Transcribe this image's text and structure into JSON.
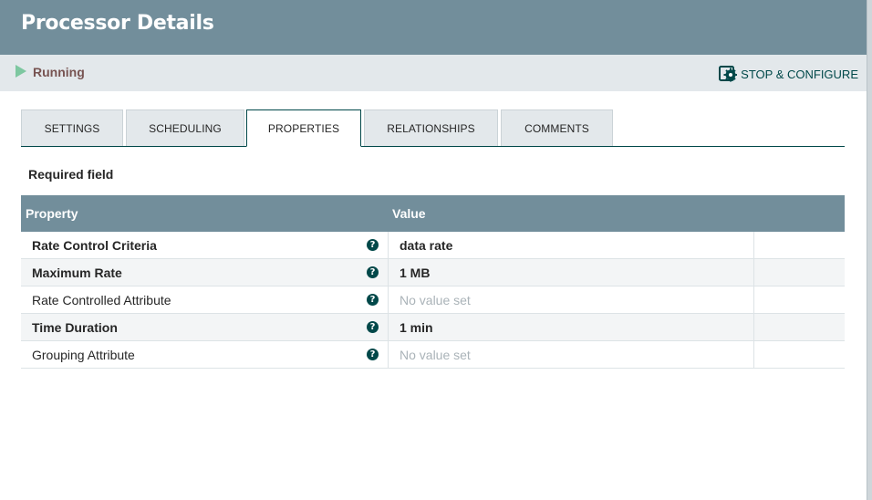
{
  "header": {
    "title": "Processor Details"
  },
  "status": {
    "state_label": "Running",
    "stop_configure_label": "STOP & CONFIGURE"
  },
  "tabs": [
    {
      "label": "SETTINGS",
      "active": false
    },
    {
      "label": "SCHEDULING",
      "active": false
    },
    {
      "label": "PROPERTIES",
      "active": true
    },
    {
      "label": "RELATIONSHIPS",
      "active": false
    },
    {
      "label": "COMMENTS",
      "active": false
    }
  ],
  "properties": {
    "required_field_label": "Required field",
    "columns": {
      "property": "Property",
      "value": "Value"
    },
    "rows": [
      {
        "name": "Rate Control Criteria",
        "value": "data rate",
        "required": true
      },
      {
        "name": "Maximum Rate",
        "value": "1 MB",
        "required": true
      },
      {
        "name": "Rate Controlled Attribute",
        "value": "No value set",
        "required": false,
        "empty": true
      },
      {
        "name": "Time Duration",
        "value": "1 min",
        "required": true
      },
      {
        "name": "Grouping Attribute",
        "value": "No value set",
        "required": false,
        "empty": true
      }
    ]
  },
  "icons": {
    "state": "play-icon",
    "stop_configure": "gear-icon",
    "help": "help-icon"
  },
  "colors": {
    "header": "#728e9b",
    "accent": "#004849",
    "running": "#7dc7a0",
    "status_text": "#775351"
  }
}
